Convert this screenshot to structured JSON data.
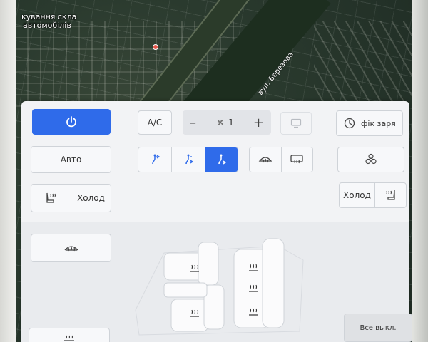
{
  "map": {
    "place_label_line1": "кування скла",
    "place_label_line2": "автомобілів",
    "street_label": "вул. Березова"
  },
  "climate": {
    "power_label": "",
    "ac_label": "A/C",
    "fan": {
      "minus": "–",
      "level": "1",
      "plus": "+"
    },
    "schedule_label": "фік заря",
    "auto_label": "Авто",
    "left_seat_mode_label": "Холод",
    "right_seat_mode_label": "Холод",
    "all_off_label": "Все выкл.",
    "active_airflow_mode": "feet"
  },
  "colors": {
    "accent": "#2f6bea",
    "panel_bg": "#f2f3f5",
    "button_bg": "#f7f8fa",
    "text": "#333333"
  },
  "icons": {
    "power": "power-icon",
    "fan": "fan-icon",
    "screen": "screen-icon",
    "clock": "clock-icon",
    "airflow_face": "airflow-face-icon",
    "airflow_face_feet": "airflow-face-feet-icon",
    "airflow_feet": "airflow-feet-icon",
    "defrost_front": "front-defrost-icon",
    "defrost_rear": "rear-defrost-icon",
    "biohazard": "biohazard-icon",
    "seat_heat": "seat-heat-icon",
    "steering_heat": "steering-heat-icon"
  }
}
